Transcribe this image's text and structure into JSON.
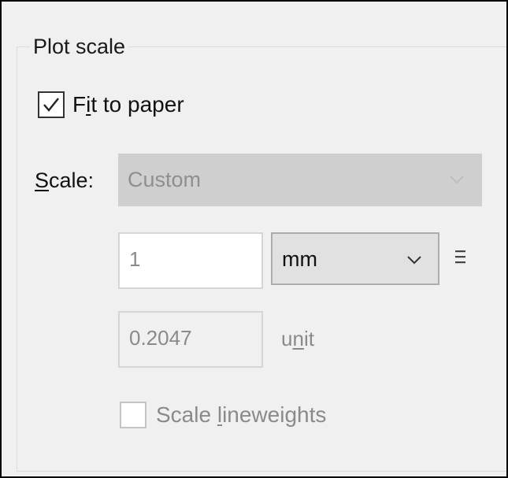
{
  "group": {
    "title": "Plot scale"
  },
  "fit_to_paper": {
    "label_pre": "F",
    "label_u": "i",
    "label_post": "t to paper",
    "checked": true
  },
  "scale": {
    "label_u": "S",
    "label_post": "cale:",
    "selected": "Custom",
    "enabled": false
  },
  "paper_units": {
    "value": "1",
    "unit": "mm"
  },
  "drawing_units": {
    "value": "0.2047",
    "label_pre": "u",
    "label_u": "n",
    "label_post": "it"
  },
  "scale_lineweights": {
    "label_pre": "Scale ",
    "label_u": "l",
    "label_post": "ineweights",
    "checked": false,
    "enabled": false
  },
  "icons": {
    "chevron": "chevron-down-icon",
    "menu": "hamburger-icon",
    "check": "checkmark-icon"
  },
  "colors": {
    "disabled_text": "#8a8a8a",
    "disabled_bg": "#cfcfcf",
    "panel_bg": "#f0f0f0"
  }
}
